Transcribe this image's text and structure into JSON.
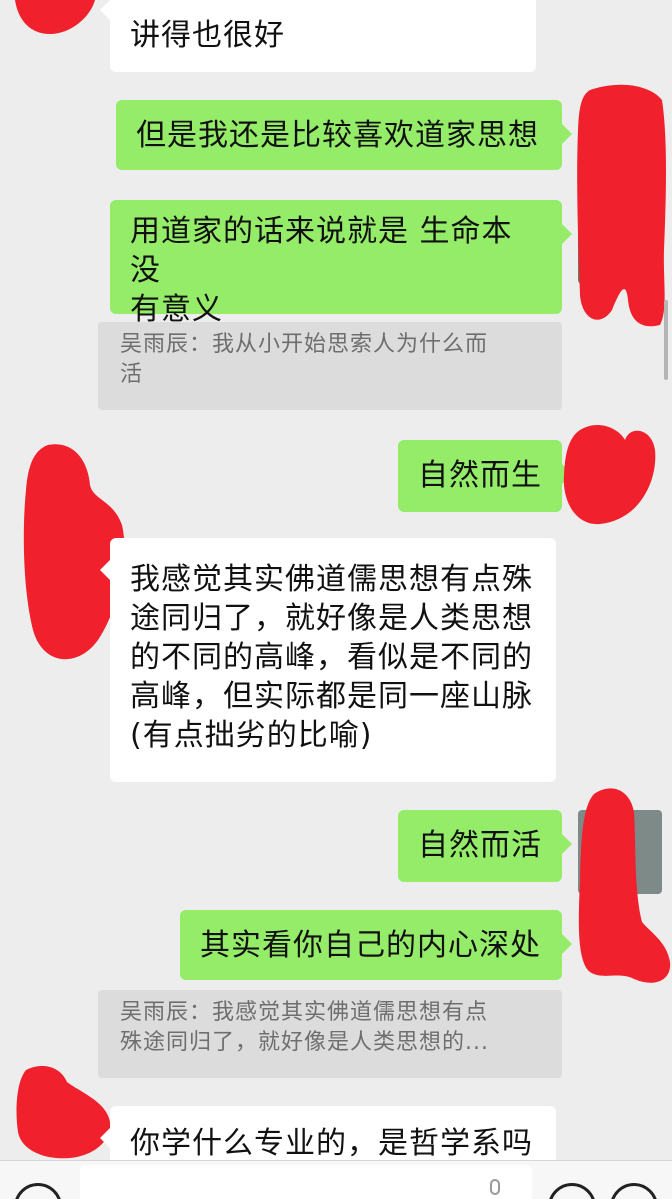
{
  "messages": [
    {
      "side": "left",
      "lines": [
        "讲得也很好"
      ]
    },
    {
      "side": "right",
      "lines": [
        "但是我还是比较喜欢道家思想"
      ]
    },
    {
      "side": "right",
      "lines": [
        "用道家的话来说就是 生命本没",
        "有意义"
      ]
    },
    {
      "type": "quote",
      "lines": [
        "吴雨辰：我从小开始思索人为什么而",
        "活"
      ]
    },
    {
      "side": "right",
      "lines": [
        "自然而生"
      ]
    },
    {
      "side": "left",
      "lines": [
        "我感觉其实佛道儒思想有点殊",
        "途同归了，就好像是人类思想",
        "的不同的高峰，看似是不同的",
        "高峰，但实际都是同一座山脉",
        "(有点拙劣的比喻)"
      ]
    },
    {
      "side": "right",
      "lines": [
        "自然而活"
      ]
    },
    {
      "side": "right",
      "lines": [
        "其实看你自己的内心深处"
      ]
    },
    {
      "type": "quote",
      "lines": [
        "吴雨辰：我感觉其实佛道儒思想有点",
        "殊途同归了，就好像是人类思想的..."
      ]
    },
    {
      "side": "left",
      "lines": [
        "你学什么专业的，是哲学系吗"
      ]
    }
  ],
  "input": {
    "value": "",
    "placeholder": ""
  },
  "icons": {
    "voice": "voice-icon",
    "emoji": "emoji-icon",
    "plus": "plus-icon"
  },
  "colors": {
    "background": "#ededed",
    "right_bubble": "#95ec69",
    "left_bubble": "#ffffff",
    "quote_bg": "#dcdcdc",
    "redaction": "#f0202c"
  }
}
